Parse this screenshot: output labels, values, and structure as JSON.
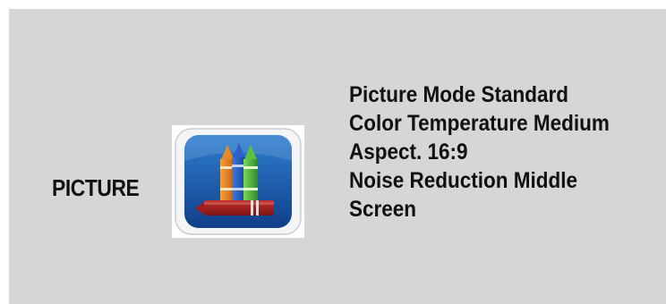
{
  "menu": {
    "title": "PICTURE",
    "icon": "crayons-icon",
    "items": [
      "Picture Mode Standard",
      "Color Temperature Medium",
      "Aspect. 16:9",
      "Noise Reduction Middle",
      "Screen"
    ]
  },
  "colors": {
    "panel_background": "#d5d6d8",
    "text": "#111111",
    "icon_blue": "#1d5aa8"
  }
}
